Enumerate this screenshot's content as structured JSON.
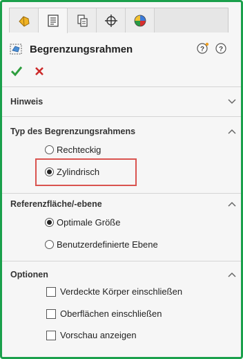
{
  "tabs": [
    {
      "name": "feature-manager",
      "icon": "feature-manager-icon"
    },
    {
      "name": "property-manager",
      "icon": "property-manager-icon"
    },
    {
      "name": "configuration-manager",
      "icon": "configuration-manager-icon"
    },
    {
      "name": "dimxpert-manager",
      "icon": "dimxpert-icon"
    },
    {
      "name": "display-manager",
      "icon": "display-manager-icon"
    }
  ],
  "header": {
    "title": "Begrenzungsrahmen"
  },
  "sections": {
    "hinweis": {
      "label": "Hinweis"
    },
    "typ": {
      "label": "Typ des Begrenzungsrahmens",
      "options": [
        "Rechteckig",
        "Zylindrisch"
      ],
      "selected": "Zylindrisch"
    },
    "referenz": {
      "label": "Referenzfläche/-ebene",
      "options": [
        "Optimale Größe",
        "Benutzerdefinierte Ebene"
      ],
      "selected": "Optimale Größe"
    },
    "optionen": {
      "label": "Optionen",
      "checks": [
        "Verdeckte Körper einschließen",
        "Oberflächen einschließen",
        "Vorschau anzeigen"
      ]
    }
  },
  "colors": {
    "frame": "#1aa04b",
    "ok": "#2e9e3e",
    "cancel": "#cc2a2a",
    "highlight": "#d9534f"
  }
}
